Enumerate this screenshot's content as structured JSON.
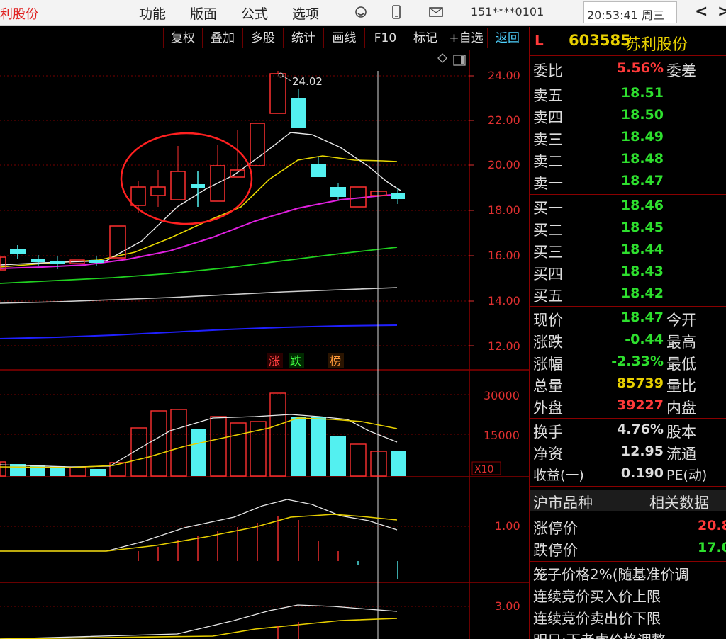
{
  "titlebar": {
    "app_title": "利股份",
    "menus": [
      "功能",
      "版面",
      "公式",
      "选项"
    ],
    "account": "151****0101",
    "clock": "20:53:41 周三",
    "nav_back": "<",
    "nav_forward": ">"
  },
  "toolbar": {
    "buttons": [
      "复权",
      "叠加",
      "多股",
      "统计",
      "画线",
      "F10",
      "标记",
      "+自选",
      "返回"
    ]
  },
  "chart": {
    "peak_label": "24.02",
    "price_axis": [
      "24.00",
      "22.00",
      "20.00",
      "18.00",
      "16.00",
      "14.00",
      "12.00"
    ],
    "volume_axis": [
      "30000",
      "15000"
    ],
    "volume_multiplier": "X10",
    "ind1_axis": "1.00",
    "ind2_axis": "3.00",
    "tags": [
      "涨",
      "跌",
      "榜"
    ]
  },
  "panel": {
    "market_flag": "L",
    "code": "603585",
    "name": "苏利股份",
    "weibi_label": "委比",
    "weibi_value": "5.56%",
    "weicha_label": "委差",
    "asks": [
      {
        "label": "卖五",
        "price": "18.51"
      },
      {
        "label": "卖四",
        "price": "18.50"
      },
      {
        "label": "卖三",
        "price": "18.49"
      },
      {
        "label": "卖二",
        "price": "18.48"
      },
      {
        "label": "卖一",
        "price": "18.47"
      }
    ],
    "bids": [
      {
        "label": "买一",
        "price": "18.46"
      },
      {
        "label": "买二",
        "price": "18.45"
      },
      {
        "label": "买三",
        "price": "18.44"
      },
      {
        "label": "买四",
        "price": "18.43"
      },
      {
        "label": "买五",
        "price": "18.42"
      }
    ],
    "stats": [
      {
        "label": "现价",
        "value": "18.47",
        "label2": "今开"
      },
      {
        "label": "涨跌",
        "value": "-0.44",
        "label2": "最高"
      },
      {
        "label": "涨幅",
        "value": "-2.33%",
        "label2": "最低"
      },
      {
        "label": "总量",
        "value": "85739",
        "label2": "量比"
      },
      {
        "label": "外盘",
        "value": "39227",
        "label2": "内盘"
      }
    ],
    "stats2": [
      {
        "label": "换手",
        "value": "4.76%",
        "label2": "股本"
      },
      {
        "label": "净资",
        "value": "12.95",
        "label2": "流通"
      },
      {
        "label": "收益(一)",
        "value": "0.190",
        "label2": "PE(动)"
      }
    ],
    "market_label": "沪市品种",
    "related_label": "相关数据",
    "limit_up_label": "涨停价",
    "limit_up_value": "20.8",
    "limit_down_label": "跌停价",
    "limit_down_value": "17.0",
    "cage_line": "笼子价格2%(随基准价调",
    "continuous_buy": "连续竞价买入价上限",
    "continuous_sell": "连续竞价卖出价下限",
    "bottom_partial": "明日:下者虚价格调整"
  }
}
